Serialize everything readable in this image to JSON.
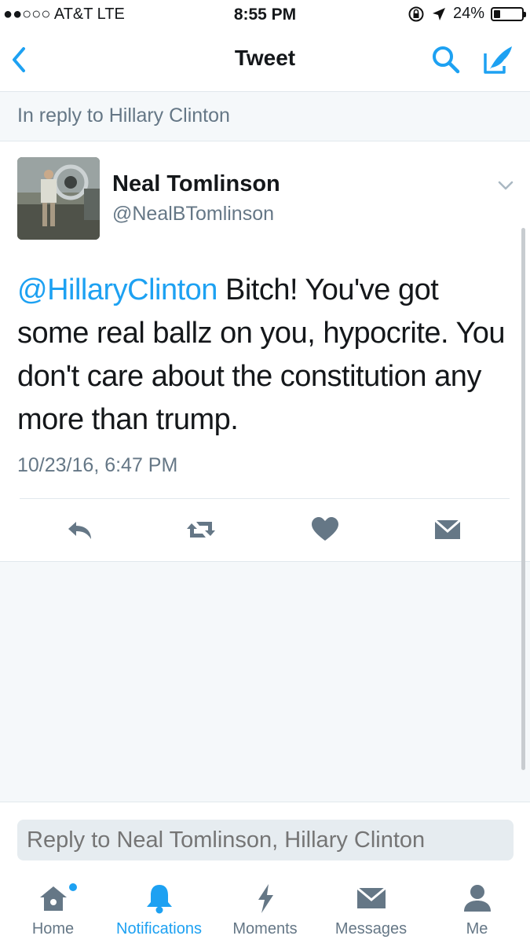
{
  "status_bar": {
    "carrier": "●●○○○ AT&T   LTE",
    "time": "8:55 PM",
    "battery": "24%",
    "battery_level": 0.24
  },
  "nav": {
    "title": "Tweet",
    "back_icon": "chevron-left-icon",
    "search_icon": "search-icon",
    "compose_icon": "compose-tweet-icon"
  },
  "reply_context": "In reply to Hillary Clinton",
  "tweet": {
    "author_name": "Neal Tomlinson",
    "author_handle": "@NealBTomlinson",
    "mention": "@HillaryClinton",
    "text": " Bitch! You've got some real ballz on you, hypocrite. You don't care about the constitution any more than trump.",
    "timestamp": "10/23/16, 6:47 PM",
    "actions": [
      "reply-icon",
      "retweet-icon",
      "heart-icon",
      "direct-message-icon"
    ]
  },
  "reply_placeholder": "Reply to Neal Tomlinson, Hillary Clinton",
  "tabs": [
    {
      "label": "Home",
      "icon": "home-icon"
    },
    {
      "label": "Notifications",
      "icon": "bell-icon",
      "active": true
    },
    {
      "label": "Moments",
      "icon": "lightning-icon"
    },
    {
      "label": "Messages",
      "icon": "envelope-icon"
    },
    {
      "label": "Me",
      "icon": "person-icon"
    }
  ],
  "colors": {
    "accent": "#1da1f2",
    "secondary_text": "#657786",
    "icon_gray": "#657786",
    "background": "#f5f8fa"
  }
}
